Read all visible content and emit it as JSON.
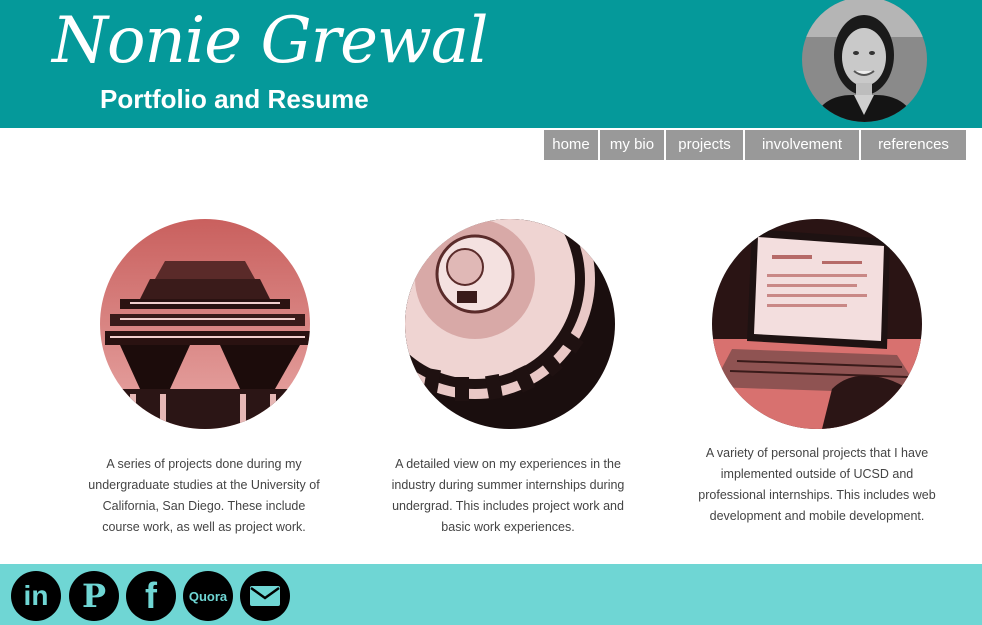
{
  "header": {
    "title": "Nonie Grewal",
    "subtitle": "Portfolio and Resume"
  },
  "nav": {
    "items": [
      {
        "label": "home"
      },
      {
        "label": "my bio"
      },
      {
        "label": "projects"
      },
      {
        "label": "involvement"
      },
      {
        "label": "references"
      }
    ]
  },
  "sections": [
    {
      "image": "library-building-image",
      "text": "A series of projects done during my undergraduate studies at the University of California, San Diego. These include course work, as well as project work."
    },
    {
      "image": "gear-image",
      "text": "A detailed view on my experiences in the industry during summer internships during undergrad. This includes project work and basic work experiences."
    },
    {
      "image": "laptop-image",
      "text": "A variety of personal projects that I have implemented outside of UCSD and professional internships. This includes web development and mobile development."
    }
  ],
  "footer": {
    "social": [
      {
        "name": "linkedin-icon",
        "label": "in"
      },
      {
        "name": "pinterest-icon",
        "label": "P"
      },
      {
        "name": "facebook-icon",
        "label": "f"
      },
      {
        "name": "quora-icon",
        "label": "Quora"
      },
      {
        "name": "email-icon",
        "label": ""
      }
    ]
  },
  "colors": {
    "header_bg": "#05999a",
    "nav_bg": "#999999",
    "footer_bg": "#6fd6d4",
    "tint": "#d8716f"
  }
}
